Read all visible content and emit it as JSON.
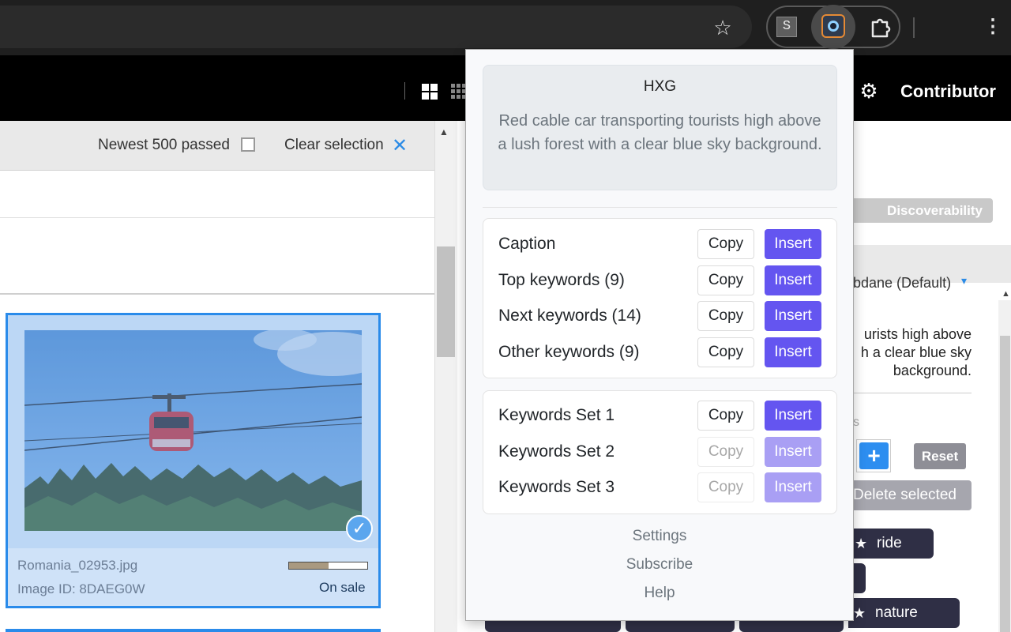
{
  "browser": {
    "star_icon": "☆",
    "ext_s_label": "S",
    "kebab_icon": "⋮"
  },
  "site_header": {
    "contributor_label": "Contributor",
    "gear_icon": "⚙"
  },
  "toolbar": {
    "newest_label": "Newest 500 passed",
    "clear_selection_label": "Clear selection",
    "clear_icon": "✕"
  },
  "image_card": {
    "filename": "Romania_02953.jpg",
    "image_id": "Image ID: 8DAEG0W",
    "status": "On sale",
    "progress_fraction": 0.5,
    "check_icon": "✓",
    "progress_fill_color": "#a99980"
  },
  "right_pane": {
    "discoverability_label": "Discoverability",
    "language_label": "bdane (Default)",
    "language_caret": "▾",
    "description_lines": [
      "urists high above",
      "h a clear blue sky",
      "background."
    ],
    "tiny_label": "s",
    "plus_label": "+",
    "reset_label": "Reset",
    "delete_selected_label": "Delete selected",
    "tags": [
      {
        "star": "★",
        "label": "ride"
      },
      {
        "star": "",
        "label": ""
      },
      {
        "star": "★",
        "label": "nature"
      }
    ]
  },
  "popup": {
    "title": "HXG",
    "summary": "Red cable car transporting tourists high above a lush forest with a clear blue sky background.",
    "accent_color": "#6455f0",
    "rows_main": [
      {
        "label": "Caption",
        "copy": "Copy",
        "insert": "Insert",
        "enabled": true
      },
      {
        "label": "Top keywords (9)",
        "copy": "Copy",
        "insert": "Insert",
        "enabled": true
      },
      {
        "label": "Next keywords (14)",
        "copy": "Copy",
        "insert": "Insert",
        "enabled": true
      },
      {
        "label": "Other keywords (9)",
        "copy": "Copy",
        "insert": "Insert",
        "enabled": true
      }
    ],
    "rows_sets": [
      {
        "label": "Keywords Set 1",
        "copy": "Copy",
        "insert": "Insert",
        "enabled": true
      },
      {
        "label": "Keywords Set 2",
        "copy": "Copy",
        "insert": "Insert",
        "enabled": false
      },
      {
        "label": "Keywords Set 3",
        "copy": "Copy",
        "insert": "Insert",
        "enabled": false
      }
    ],
    "links": {
      "settings": "Settings",
      "subscribe": "Subscribe",
      "help": "Help"
    }
  }
}
